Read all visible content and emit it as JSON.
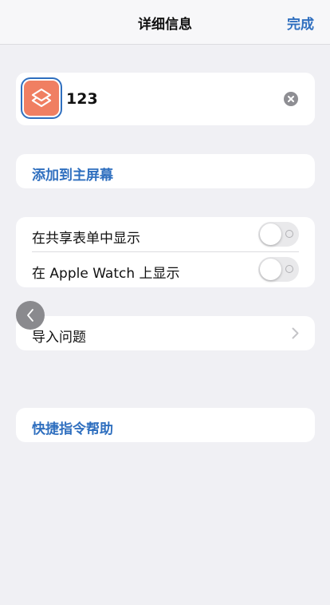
{
  "nav": {
    "title": "详细信息",
    "done_label": "完成"
  },
  "shortcut": {
    "name": "123",
    "icon": "shortcuts-layers-icon",
    "icon_color": "#f07f62"
  },
  "add_to_home": {
    "label": "添加到主屏幕"
  },
  "toggles": [
    {
      "label": "在共享表单中显示",
      "on": false
    },
    {
      "label": "在 Apple Watch 上显示",
      "on": false
    }
  ],
  "import_questions": {
    "label": "导入问题"
  },
  "help": {
    "label": "快捷指令帮助"
  },
  "colors": {
    "accent": "#2f6fbf",
    "background": "#f0f0f4"
  }
}
